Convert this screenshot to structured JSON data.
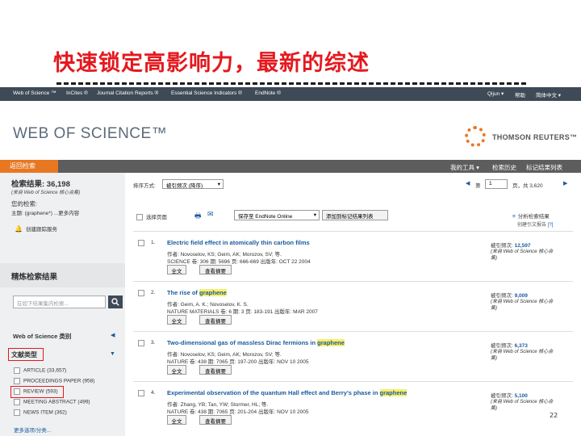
{
  "slide": {
    "title": "快速锁定高影响力，最新的综述",
    "page_number": "22"
  },
  "topbar": {
    "items": [
      "Web of Science ™",
      "InCites ®",
      "Journal Citation Reports ®",
      "Essential Science Indicators ®",
      "EndNote ®"
    ],
    "user": "Qijun ▾",
    "help": "帮助",
    "lang": "简体中文 ▾"
  },
  "brand": {
    "wos": "WEB OF SCIENCE™",
    "tr": "THOMSON REUTERS™"
  },
  "navbar": {
    "back": "返回检索",
    "my_tools": "我的工具 ▾",
    "history": "检索历史",
    "marked": "标记结果列表"
  },
  "sidebar": {
    "results_label": "检索结果: 36,198",
    "results_sub": "(来自 Web of Science 核心合集)",
    "query_label": "您的检索:",
    "query_text": "主题: (graphene*) ...更多内容",
    "alert": "创建跟踪服务",
    "refine_title": "精炼检索结果",
    "search_placeholder": "在如下结果集内检索...",
    "wos_category": "Web of Science 类别",
    "doctype": "文献类型",
    "doctype_items": [
      "ARTICLE (33,657)",
      "PROCEEDINGS PAPER (958)",
      "REVIEW (593)",
      "MEETING ABSTRACT (499)",
      "NEWS ITEM (362)"
    ],
    "more": "更多选项/分类..."
  },
  "main": {
    "sort_label": "排序方式:",
    "sort_value": "被引频次 (降序)",
    "page_label": "第",
    "page_value": "1",
    "page_total": "页，共 3,620",
    "select_page": "选择页面",
    "save_endnote": "保存至 EndNote Online",
    "add_marked": "添加到标记结果列表",
    "analyze": "分析检索结果",
    "citation_report": "创建引文报告",
    "records": [
      {
        "num": "1.",
        "title_pre": "Electric field effect in atomically thin carbon films",
        "title_hl": "",
        "title_post": "",
        "authors": "作者: Novoselov, KS; Geim, AK; Morozov, SV; 等.",
        "source": "SCIENCE  卷: 306  期: 5696  页: 666-669  出版年: OCT 22 2004",
        "cite": "12,597",
        "buttons": [
          "全文",
          "查看摘要"
        ]
      },
      {
        "num": "2.",
        "title_pre": "The rise of ",
        "title_hl": "graphene",
        "title_post": "",
        "authors": "作者: Geim, A. K.; Novoselov, K. S.",
        "source": "NATURE MATERIALS  卷: 6  期: 3  页: 183-191  出版年: MAR 2007",
        "cite": "9,009",
        "buttons": [
          "全文",
          "查看摘要"
        ]
      },
      {
        "num": "3.",
        "title_pre": "Two-dimensional gas of massless Dirac fermions in ",
        "title_hl": "graphene",
        "title_post": "",
        "authors": "作者: Novoselov, KS; Geim, AK; Morozov, SV; 等.",
        "source": "NATURE  卷: 438  期: 7065  页: 197-200  出版年: NOV 10 2005",
        "cite": "6,373",
        "buttons": [
          "全文",
          "查看摘要"
        ]
      },
      {
        "num": "4.",
        "title_pre": "Experimental observation of the quantum Hall effect and Berry's phase in ",
        "title_hl": "graphene",
        "title_post": "",
        "authors": "作者: Zhang, YB; Tan, YW; Stormer, HL; 等.",
        "source": "NATURE  卷: 438  期: 7065  页: 201-204  出版年: NOV 10 2005",
        "cite": "5,100",
        "buttons": [
          "全文",
          "查看摘要"
        ]
      }
    ],
    "cite_label": "被引频次:",
    "cite_sub": "(来自 Web of Science 核心合集)"
  },
  "colors": {
    "accent": "#e87722",
    "highlight": "#e4191e",
    "link": "#1a5aa0",
    "topbar": "#3e4a57"
  }
}
